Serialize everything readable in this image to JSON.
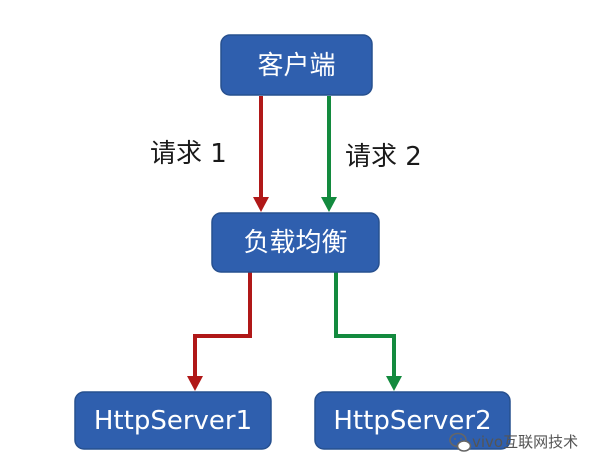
{
  "nodes": {
    "client": "客户端",
    "load_balancer": "负载均衡",
    "server1": "HttpServer1",
    "server2": "HttpServer2"
  },
  "edges": {
    "request1": "请求 1",
    "request2": "请求 2"
  },
  "colors": {
    "node_fill": "#2f5fae",
    "path_red": "#b01818",
    "path_green": "#138a3e"
  },
  "watermark": {
    "text": "vivo互联网技术",
    "icon": "wechat-icon"
  }
}
